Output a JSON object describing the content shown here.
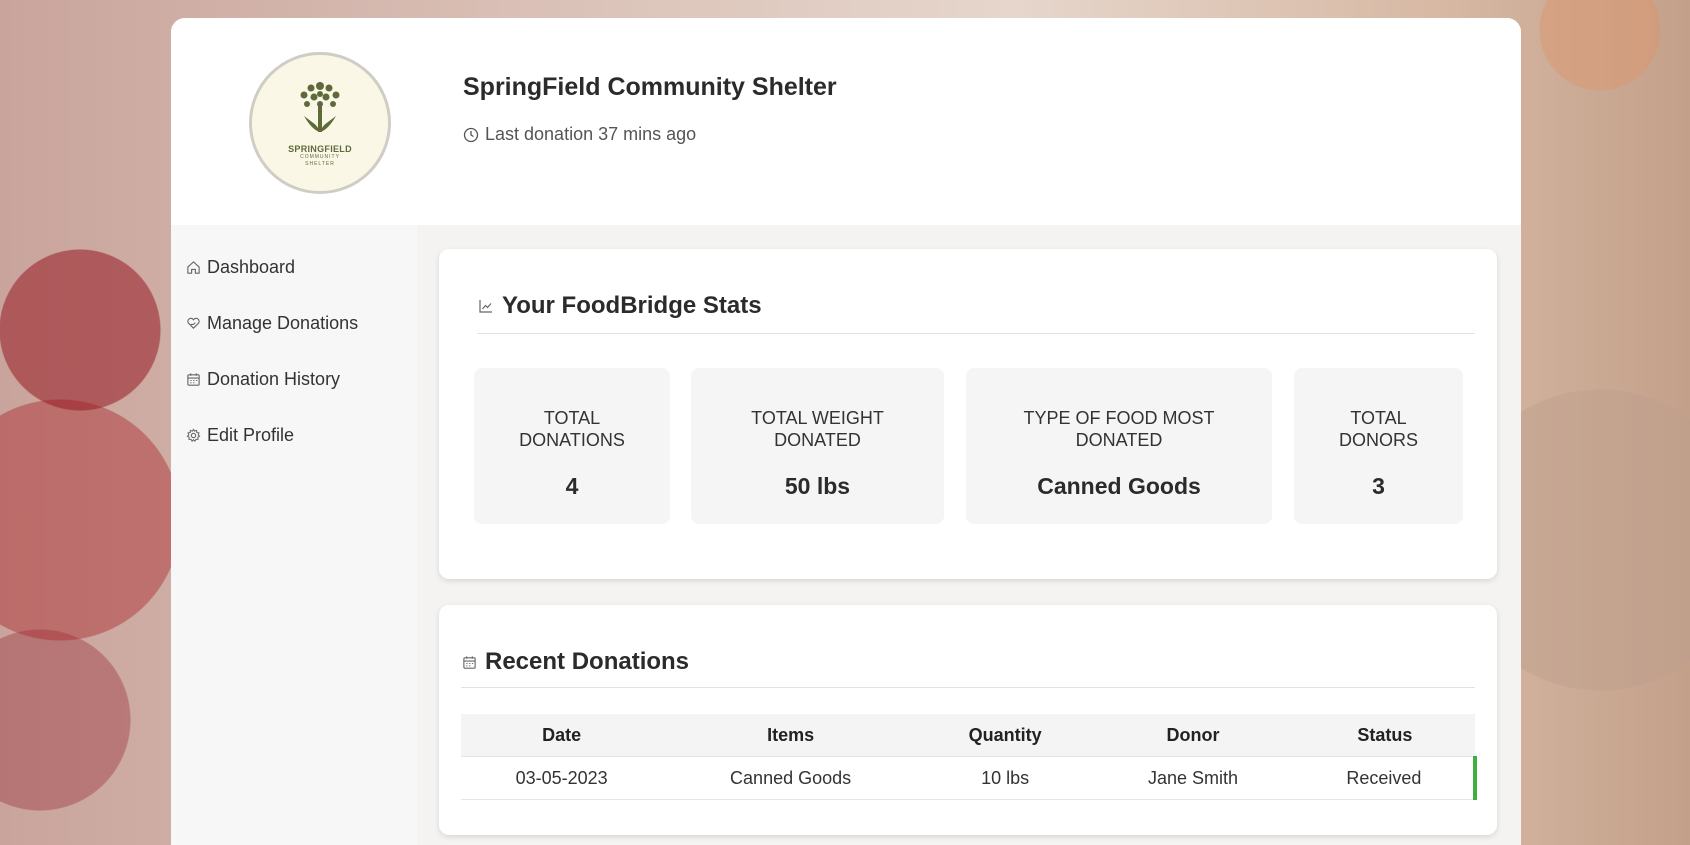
{
  "header": {
    "logo": {
      "name": "SPRINGFIELD",
      "sub_line1": "COMMUNITY",
      "sub_line2": "SHELTER"
    },
    "shelter_name": "SpringField Community Shelter",
    "last_donation": "Last donation 37 mins ago"
  },
  "sidebar": {
    "items": [
      {
        "label": "Dashboard",
        "icon": "home-icon"
      },
      {
        "label": "Manage Donations",
        "icon": "heart-hand-icon"
      },
      {
        "label": "Donation History",
        "icon": "calendar-icon"
      },
      {
        "label": "Edit Profile",
        "icon": "gear-icon"
      }
    ]
  },
  "stats": {
    "title": "Your FoodBridge Stats",
    "cards": [
      {
        "label_line1": "TOTAL",
        "label_line2": "DONATIONS",
        "value": "4"
      },
      {
        "label_line1": "TOTAL WEIGHT",
        "label_line2": "DONATED",
        "value": "50 lbs"
      },
      {
        "label_line1": "TYPE OF FOOD MOST",
        "label_line2": "DONATED",
        "value": "Canned Goods"
      },
      {
        "label_line1": "TOTAL",
        "label_line2": "DONORS",
        "value": "3"
      }
    ]
  },
  "donations": {
    "title": "Recent Donations",
    "columns": [
      "Date",
      "Items",
      "Quantity",
      "Donor",
      "Status"
    ],
    "rows": [
      {
        "date": "03-05-2023",
        "items": "Canned Goods",
        "quantity": "10 lbs",
        "donor": "Jane Smith",
        "status": "Received"
      }
    ]
  },
  "colors": {
    "status_received": "#3fae3f",
    "logo_green": "#5d6b3a"
  }
}
